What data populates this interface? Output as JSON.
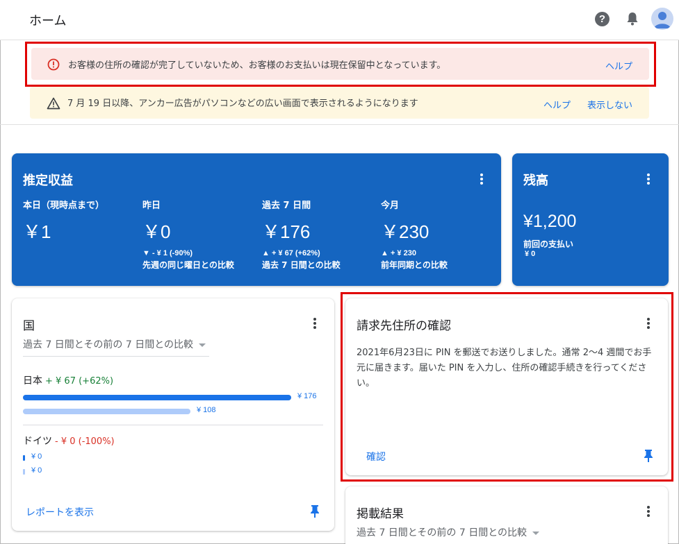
{
  "header": {
    "title": "ホーム",
    "icons": [
      "help-icon",
      "notifications-icon",
      "avatar"
    ]
  },
  "banners": {
    "error": {
      "text": "お客様の住所の確認が完了していないため、お客様のお支払いは現在保留中となっています。",
      "help_label": "ヘルプ"
    },
    "warning": {
      "text": "7 月 19 日以降、アンカー広告がパソコンなどの広い画面で表示されるようになります",
      "help_label": "ヘルプ",
      "dismiss_label": "表示しない"
    }
  },
  "earnings": {
    "title": "推定収益",
    "metrics": [
      {
        "label": "本日（現時点まで）",
        "value": "￥1",
        "delta": "",
        "compare": ""
      },
      {
        "label": "昨日",
        "value": "￥0",
        "delta": "▼ - ¥ 1 (-90%)",
        "compare": "先週の同じ曜日との比較"
      },
      {
        "label": "過去 7 日間",
        "value": "￥176",
        "delta": "▲ + ¥ 67 (+62%)",
        "compare": "過去 7 日間との比較"
      },
      {
        "label": "今月",
        "value": "￥230",
        "delta": "▲ + ¥ 230",
        "compare": "前年同期との比較"
      }
    ]
  },
  "balance": {
    "title": "残高",
    "value": "¥1,200",
    "last_payment_label": "前回の支払い",
    "last_payment_value": "¥ 0"
  },
  "country": {
    "title": "国",
    "compare_dropdown": "過去 7 日間とその前の 7 日間との比較",
    "rows": [
      {
        "name": "日本",
        "delta": "+ ¥ 67 (+62%)",
        "current": 176,
        "previous": 108,
        "current_label": "¥ 176",
        "previous_label": "¥ 108"
      },
      {
        "name": "ドイツ",
        "delta": "- ¥ 0 (-100%)",
        "current": 0,
        "previous": 0,
        "current_label": "¥ 0",
        "previous_label": "¥ 0"
      }
    ],
    "report_link": "レポートを表示"
  },
  "billing_address": {
    "title": "請求先住所の確認",
    "body": "2021年6月23日に PIN を郵送でお送りしました。通常 2〜4 週間でお手元に届きます。届いた PIN を入力し、住所の確認手続きを行ってください。",
    "confirm_link": "確認"
  },
  "performance": {
    "title": "掲載結果",
    "compare_dropdown": "過去 7 日間とその前の 7 日間との比較"
  },
  "colors": {
    "brand_blue": "#1565c0",
    "link_blue": "#1a73e8",
    "error_bg": "#fce8e6",
    "warning_bg": "#fef7e0",
    "positive_green": "#188038",
    "negative_red": "#d93025",
    "highlight_outline": "#e00000"
  }
}
